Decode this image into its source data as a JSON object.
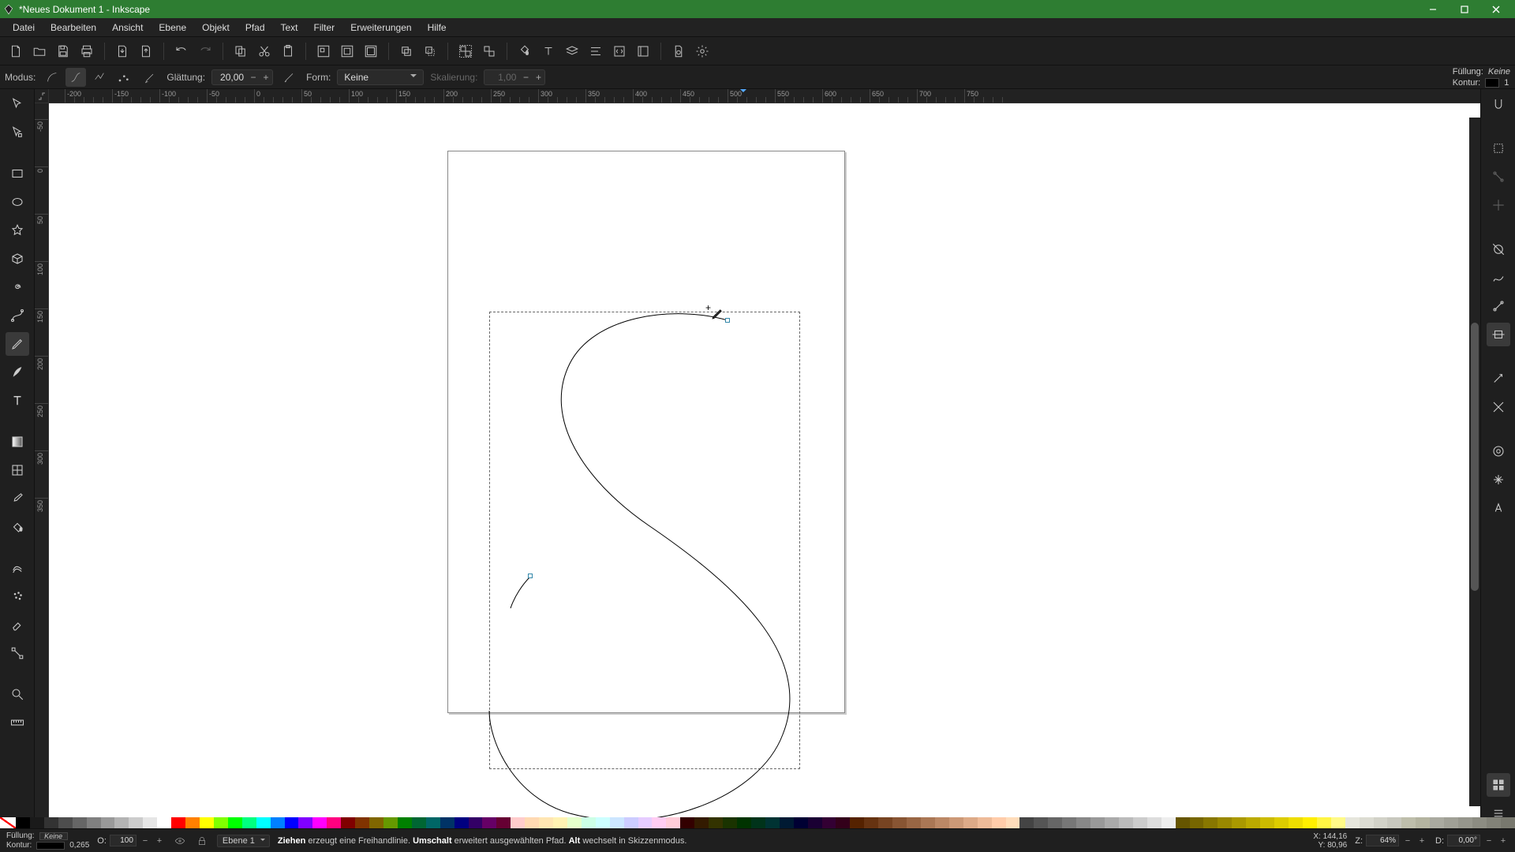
{
  "window": {
    "title": "*Neues Dokument 1 - Inkscape"
  },
  "menu": {
    "items": [
      "Datei",
      "Bearbeiten",
      "Ansicht",
      "Ebene",
      "Objekt",
      "Pfad",
      "Text",
      "Filter",
      "Erweiterungen",
      "Hilfe"
    ]
  },
  "toolOptions": {
    "modeLabel": "Modus:",
    "smoothingLabel": "Glättung:",
    "smoothingValue": "20,00",
    "shapeLabel": "Form:",
    "shapeValue": "Keine",
    "scaleLabel": "Skalierung:",
    "scaleValue": "1,00",
    "fillLabel": "Füllung:",
    "fillValue": "Keine",
    "strokeLabel": "Kontur:",
    "strokeValue": "1"
  },
  "ruler": {
    "hTicks": [
      "-200",
      "-150",
      "-100",
      "-50",
      "0",
      "50",
      "100",
      "150",
      "200",
      "250",
      "300",
      "350",
      "400",
      "450",
      "500",
      "550",
      "600",
      "650",
      "700",
      "750"
    ],
    "vTicks": [
      "-50",
      "0",
      "50",
      "100",
      "150",
      "200",
      "250",
      "300",
      "350"
    ]
  },
  "status": {
    "fillLabel": "Füllung:",
    "fillValue": "Keine",
    "strokeLabel": "Kontur:",
    "strokeWidth": "0,265",
    "opacityLabel": "O:",
    "opacityValue": "100",
    "layer": "Ebene 1",
    "hint_b1": "Ziehen",
    "hint_t1": " erzeugt eine Freihandlinie. ",
    "hint_b2": "Umschalt",
    "hint_t2": " erweitert ausgewählten Pfad. ",
    "hint_b3": "Alt",
    "hint_t3": " wechselt in Skizzenmodus.",
    "xLabel": "X:",
    "xValue": "144,16",
    "yLabel": "Y:",
    "yValue": "80,96",
    "zoomLabel": "Z:",
    "zoomValue": "64%",
    "rotLabel": "D:",
    "rotValue": "0,00°"
  },
  "palette": {
    "colors": [
      "#000000",
      "#1a1a1a",
      "#333333",
      "#4d4d4d",
      "#666666",
      "#808080",
      "#999999",
      "#b3b3b3",
      "#cccccc",
      "#e6e6e6",
      "#ffffff",
      "#ff0000",
      "#ff8000",
      "#ffff00",
      "#80ff00",
      "#00ff00",
      "#00ff80",
      "#00ffff",
      "#0080ff",
      "#0000ff",
      "#8000ff",
      "#ff00ff",
      "#ff0080",
      "#800000",
      "#803300",
      "#806600",
      "#669900",
      "#008000",
      "#006633",
      "#006666",
      "#003366",
      "#000080",
      "#330066",
      "#660066",
      "#660033",
      "#ffcccc",
      "#ffd9b3",
      "#ffe6b3",
      "#fff2b3",
      "#e6ffcc",
      "#ccffe6",
      "#ccffff",
      "#cce6ff",
      "#ccccff",
      "#e6ccff",
      "#ffccf2",
      "#ffccd9",
      "#330000",
      "#331a00",
      "#333300",
      "#1a3300",
      "#003300",
      "#00331a",
      "#003333",
      "#001a33",
      "#000033",
      "#1a0033",
      "#330033",
      "#33001a",
      "#552200",
      "#663311",
      "#774422",
      "#885533",
      "#996644",
      "#aa7755",
      "#bb8866",
      "#cc9977",
      "#ddaa88",
      "#eebb99",
      "#ffccaa",
      "#ffddbb",
      "#444444",
      "#555555",
      "#666666",
      "#777777",
      "#888888",
      "#999999",
      "#aaaaaa",
      "#bbbbbb",
      "#cccccc",
      "#dddddd",
      "#eeeeee",
      "#665500",
      "#776600",
      "#887700",
      "#998800",
      "#aa9900",
      "#bbaa00",
      "#ccbb00",
      "#ddcc00",
      "#eedd00",
      "#ffee00",
      "#fff544",
      "#fffa88",
      "#e6e6dc",
      "#dcdcd2",
      "#d2d2c8",
      "#c8c8be",
      "#bebeab",
      "#b4b4a0",
      "#aaaaa0",
      "#a0a096",
      "#96968c",
      "#8c8c82",
      "#828278",
      "#78786e"
    ]
  }
}
